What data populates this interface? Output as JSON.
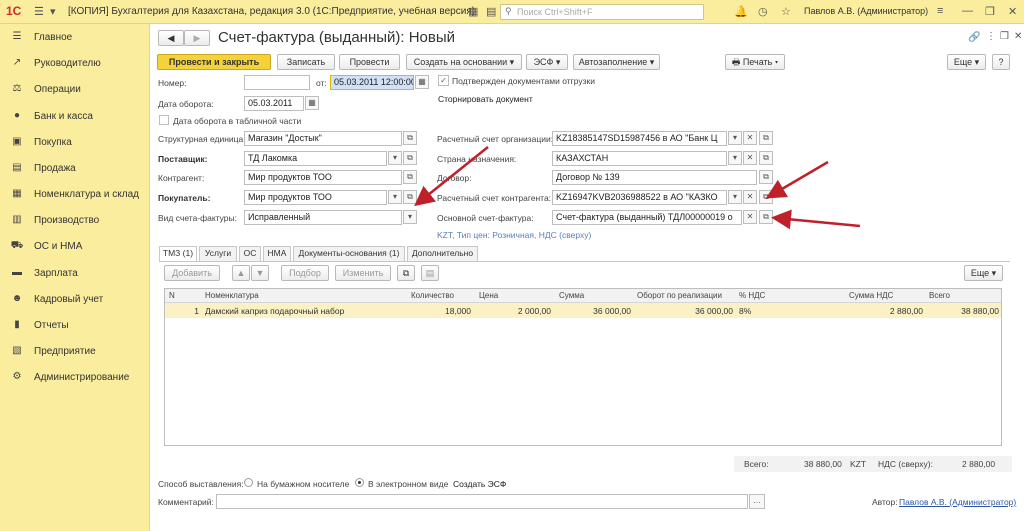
{
  "app": {
    "logo": "1С",
    "title": "[КОПИЯ] Бухгалтерия для Казахстана, редакция 3.0  (1С:Предприятие, учебная версия)",
    "search_placeholder": "Поиск Ctrl+Shift+F",
    "user": "Павлов А.В. (Администратор)"
  },
  "sidebar": {
    "items": [
      {
        "label": "Главное",
        "icon": "menu-icon"
      },
      {
        "label": "Руководителю",
        "icon": "trend-icon"
      },
      {
        "label": "Операции",
        "icon": "operations-icon"
      },
      {
        "label": "Банк и касса",
        "icon": "bank-icon"
      },
      {
        "label": "Покупка",
        "icon": "purchase-icon"
      },
      {
        "label": "Продажа",
        "icon": "sales-icon"
      },
      {
        "label": "Номенклатура и склад",
        "icon": "warehouse-icon"
      },
      {
        "label": "Производство",
        "icon": "production-icon"
      },
      {
        "label": "ОС и НМА",
        "icon": "assets-icon"
      },
      {
        "label": "Зарплата",
        "icon": "salary-icon"
      },
      {
        "label": "Кадровый учет",
        "icon": "personnel-icon"
      },
      {
        "label": "Отчеты",
        "icon": "reports-icon"
      },
      {
        "label": "Предприятие",
        "icon": "enterprise-icon"
      },
      {
        "label": "Администрирование",
        "icon": "admin-icon"
      }
    ]
  },
  "form": {
    "title": "Счет-фактура (выданный): Новый"
  },
  "toolbar": {
    "post_close": "Провести и закрыть",
    "save": "Записать",
    "post": "Провести",
    "create_based": "Создать на основании",
    "esf": "ЭСФ",
    "autofill": "Автозаполнение",
    "print": "Печать",
    "more": "Еще",
    "help": "?"
  },
  "fields": {
    "number_label": "Номер:",
    "number_value": "",
    "date_from_label": "от:",
    "date_value": "05.03.2011 12:00:00",
    "confirmed_label": "Подтвержден документами отгрузки",
    "storno_label": "Сторнировать документ",
    "turnover_date_label": "Дата оборота:",
    "turnover_date_value": "05.03.2011",
    "turnover_in_table_label": "Дата оборота в табличной части",
    "unit_label": "Структурная единица:",
    "unit_value": "Магазин \"Достык\"",
    "org_account_label": "Расчетный счет организации:",
    "org_account_value": "KZ18385147SD15987456 в АО \"Банк Ц",
    "supplier_label": "Поставщик:",
    "supplier_value": "ТД Лакомка",
    "country_label": "Страна назначения:",
    "country_value": "КАЗАХСТАН",
    "counterparty_label": "Контрагент:",
    "counterparty_value": "Мир продуктов ТОО",
    "contract_label": "Договор:",
    "contract_value": "Договор № 139",
    "buyer_label": "Покупатель:",
    "buyer_value": "Мир продуктов ТОО",
    "cp_account_label": "Расчетный счет контрагента:",
    "cp_account_value": "KZ16947KVB2036988522 в АО \"КАЗКО",
    "invoice_type_label": "Вид счета-фактуры:",
    "invoice_type_value": "Исправленный",
    "base_invoice_label": "Основной счет-фактура:",
    "base_invoice_value": "Счет-фактура (выданный) ТДЛ00000019 о",
    "price_info": "KZT, Тип цен: Розничная, НДС (сверху)"
  },
  "tabs": [
    {
      "label": "ТМЗ (1)"
    },
    {
      "label": "Услуги"
    },
    {
      "label": "ОС"
    },
    {
      "label": "НМА"
    },
    {
      "label": "Документы-основания (1)"
    },
    {
      "label": "Дополнительно"
    }
  ],
  "table_toolbar": {
    "add": "Добавить",
    "select": "Подбор",
    "change": "Изменить",
    "more": "Еще"
  },
  "table": {
    "headers": [
      "N",
      "Номенклатура",
      "Количество",
      "Цена",
      "Сумма",
      "Оборот по реализации",
      "% НДС",
      "Сумма НДС",
      "Всего"
    ],
    "rows": [
      [
        "1",
        "Дамский каприз подарочный набор",
        "18,000",
        "2 000,00",
        "36 000,00",
        "36 000,00",
        "8%",
        "2 880,00",
        "38 880,00"
      ]
    ]
  },
  "totals": {
    "total_label": "Всего:",
    "total_value": "38 880,00",
    "currency": "KZT",
    "vat_label": "НДС (сверху):",
    "vat_value": "2 880,00"
  },
  "footer": {
    "method_label": "Способ выставления:",
    "paper_label": "На бумажном носителе",
    "electronic_label": "В электронном виде",
    "create_esf": "Создать ЭСФ",
    "comment_label": "Комментарий:",
    "author_label": "Автор:",
    "author_value": "Павлов А.В. (Администратор)"
  },
  "colors": {
    "accent_yellow": "#f5d23a",
    "sidebar_bg": "#fbed9e",
    "arrow_red": "#c0202a"
  }
}
